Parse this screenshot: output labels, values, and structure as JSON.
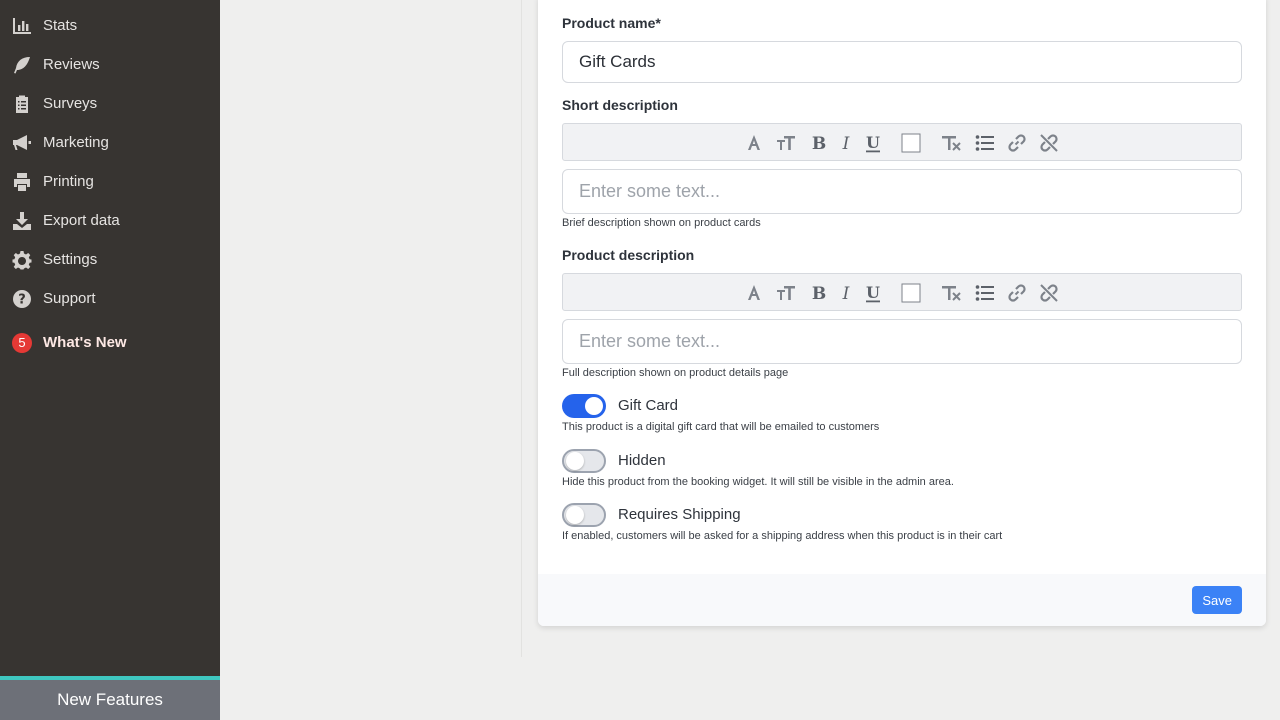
{
  "sidebar": {
    "items": [
      {
        "label": "Stats",
        "icon": "bar-chart-icon"
      },
      {
        "label": "Reviews",
        "icon": "feather-icon"
      },
      {
        "label": "Surveys",
        "icon": "clipboard-icon"
      },
      {
        "label": "Marketing",
        "icon": "megaphone-icon"
      },
      {
        "label": "Printing",
        "icon": "printer-icon"
      },
      {
        "label": "Export data",
        "icon": "download-icon"
      },
      {
        "label": "Settings",
        "icon": "gear-icon"
      },
      {
        "label": "Support",
        "icon": "question-circle-icon"
      }
    ],
    "whats_new": {
      "label": "What's New",
      "badge": "5"
    },
    "new_features": "New Features"
  },
  "form": {
    "product_name": {
      "label": "Product name*",
      "value": "Gift Cards"
    },
    "short_description": {
      "label": "Short description",
      "placeholder": "Enter some text...",
      "help": "Brief description shown on product cards"
    },
    "product_description": {
      "label": "Product description",
      "placeholder": "Enter some text...",
      "help": "Full description shown on product details page"
    },
    "toolbar_buttons": [
      "font-color-icon",
      "font-size-icon",
      "bold-icon",
      "italic-icon",
      "underline-icon",
      "background-color-icon",
      "clear-format-icon",
      "bullet-list-icon",
      "link-icon",
      "unlink-icon"
    ],
    "toggles": {
      "gift_card": {
        "label": "Gift Card",
        "enabled": true,
        "help": "This product is a digital gift card that will be emailed to customers"
      },
      "hidden": {
        "label": "Hidden",
        "enabled": false,
        "help": "Hide this product from the booking widget. It will still be visible in the admin area."
      },
      "requires_shipping": {
        "label": "Requires Shipping",
        "enabled": false,
        "help": "If enabled, customers will be asked for a shipping address when this product is in their cart"
      }
    },
    "save_label": "Save"
  },
  "colors": {
    "sidebar_bg": "#373431",
    "accent": "#2563eb",
    "save_button": "#3b82f6",
    "badge": "#e53935",
    "new_features_border": "#3fc7c0"
  }
}
